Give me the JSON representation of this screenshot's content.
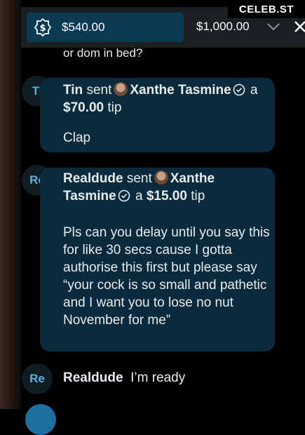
{
  "watermark": "CELEB.ST",
  "tip_bar": {
    "selected_amount": "$540.00",
    "option_amount": "$1,000.00"
  },
  "cut_text": "or dom in bed?",
  "messages": [
    {
      "initials": "Ti",
      "sender": "Tin",
      "sent": "sent",
      "recipient": "Xanthe Tasmine",
      "article": "a",
      "amount": "$70.00",
      "tip_word": "tip",
      "body": "Clap"
    },
    {
      "initials": "Re",
      "sender": "Realdude",
      "sent": "sent",
      "recipient_first": "Xanthe",
      "recipient_last": "Tasmine",
      "article": "a",
      "amount": "$15.00",
      "tip_word": "tip",
      "body": "Pls can you delay until you say this for like 30 secs cause I gotta authorise this first but please say “your cock is so small and pathetic and I want you to lose no nut November for me”"
    },
    {
      "initials": "Re",
      "sender": "Realdude",
      "text": "I’m ready"
    }
  ],
  "colors": {
    "bubble": "#0b2a3b",
    "accent": "#4fb3e0",
    "tip_pill": "#0b3b52"
  }
}
